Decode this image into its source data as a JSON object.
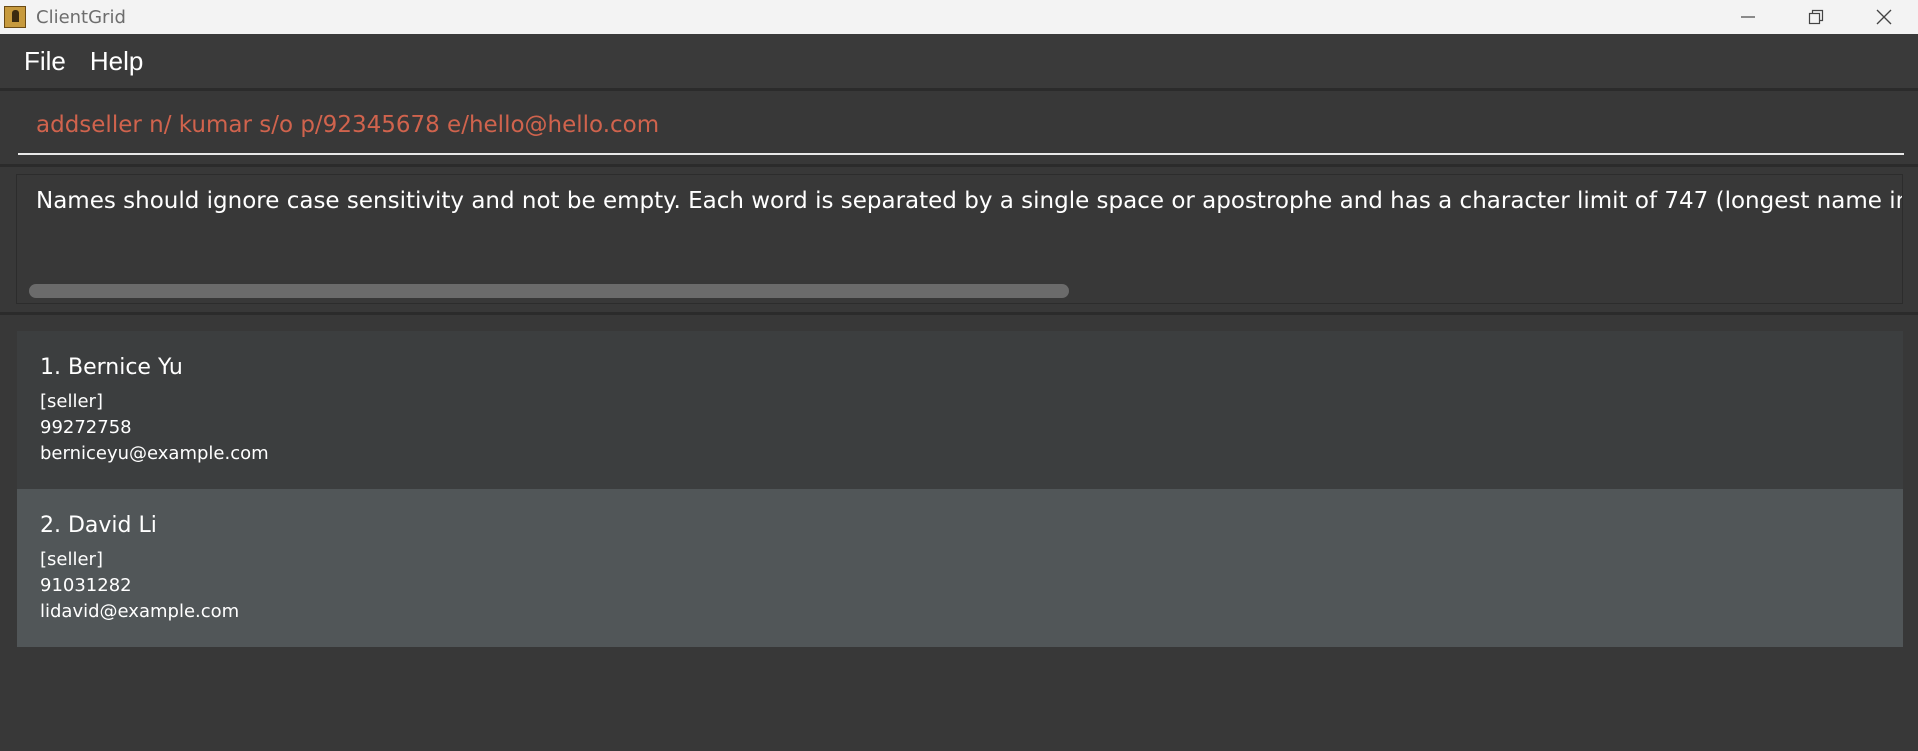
{
  "window": {
    "title": "ClientGrid"
  },
  "menu": {
    "file": "File",
    "help": "Help"
  },
  "command": {
    "value": "addseller n/ kumar s/o p/92345678 e/hello@hello.com"
  },
  "result": {
    "message": "Names should ignore case sensitivity and not be empty. Each word is separated by a single space or apostrophe and has a character limit of 747 (longest name in th"
  },
  "clients": [
    {
      "name": "1. Bernice Yu",
      "tag": "[seller]",
      "phone": "99272758",
      "email": "berniceyu@example.com"
    },
    {
      "name": "2. David Li",
      "tag": "[seller]",
      "phone": "91031282",
      "email": "lidavid@example.com"
    }
  ],
  "icons": {
    "app": "app-icon",
    "minimize": "minimize-icon",
    "restore": "restore-icon",
    "close": "close-icon"
  },
  "colors": {
    "command_text": "#d0634d",
    "background": "#383838",
    "selected_card": "#515658"
  }
}
